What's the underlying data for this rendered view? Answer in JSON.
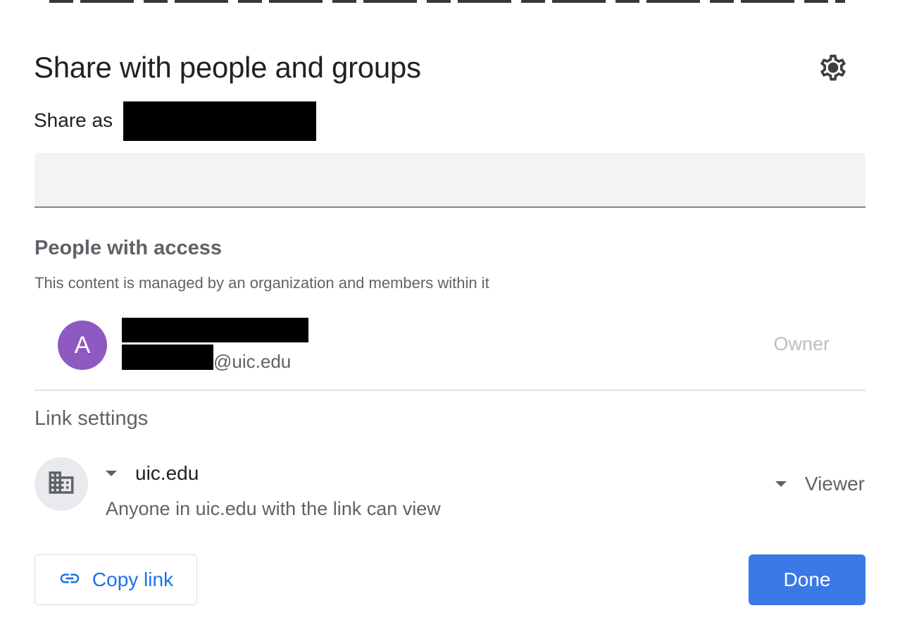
{
  "dialog": {
    "title": "Share with people and groups",
    "settings_icon": "gear-icon",
    "share_as_label": "Share as"
  },
  "add_people": {
    "placeholder": "",
    "value": ""
  },
  "people_with_access": {
    "heading": "People with access",
    "managed_note": "This content is managed by an organization and members within it",
    "owner": {
      "avatar_initial": "A",
      "avatar_color": "#8e59c0",
      "email_suffix": "@uic.edu",
      "role": "Owner"
    }
  },
  "link_settings": {
    "heading": "Link settings",
    "scope_icon": "building-icon",
    "scope_label": "uic.edu",
    "scope_description": "Anyone in uic.edu with the link can view",
    "role_label": "Viewer"
  },
  "footer": {
    "copy_link_icon": "link-icon",
    "copy_link_label": "Copy link",
    "done_label": "Done"
  },
  "colors": {
    "accent": "#1a73e8",
    "primary_button": "#3b78e7",
    "secondary_text": "#5f6368"
  }
}
